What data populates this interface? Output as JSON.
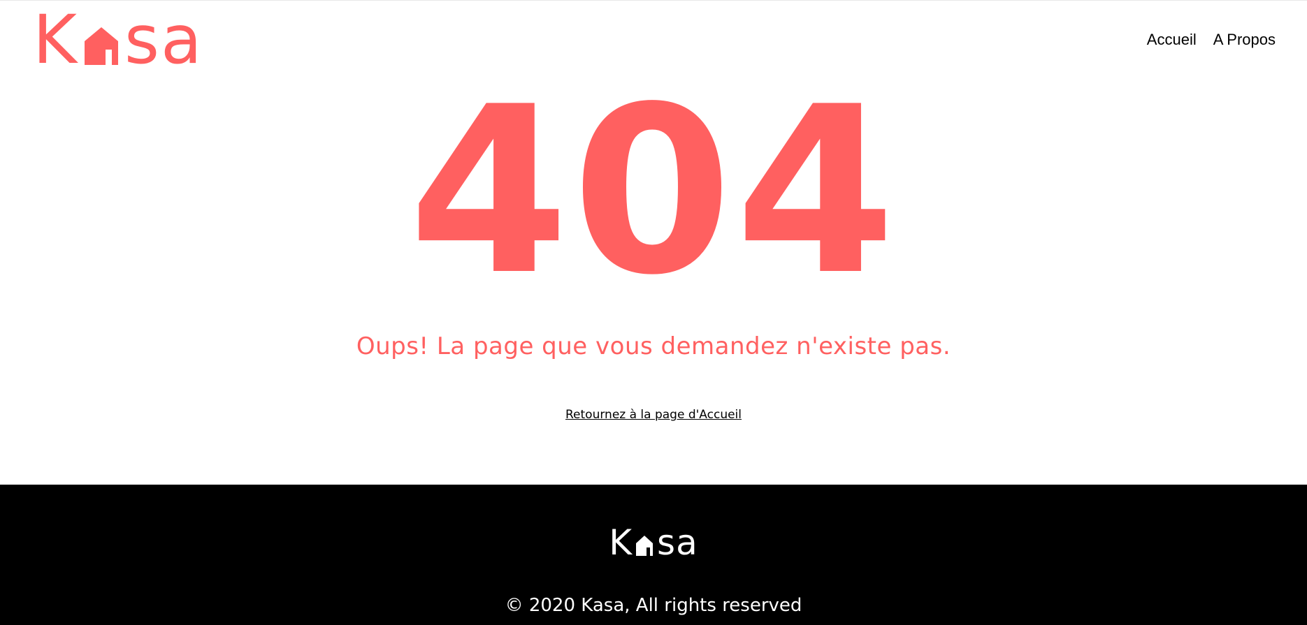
{
  "header": {
    "logo": {
      "k": "K",
      "sa": "sa",
      "icon": "house-icon",
      "color": "#ff6060"
    },
    "nav": [
      {
        "label": "Accueil"
      },
      {
        "label": "A Propos"
      }
    ]
  },
  "main": {
    "error_code": "404",
    "message": "Oups! La page que vous demandez n'existe pas.",
    "home_link": "Retournez à la page d'Accueil",
    "accent_color": "#ff6060"
  },
  "footer": {
    "logo": {
      "k": "K",
      "sa": "sa",
      "icon": "house-icon"
    },
    "copyright": "© 2020 Kasa, All rights reserved",
    "background": "#000000"
  }
}
